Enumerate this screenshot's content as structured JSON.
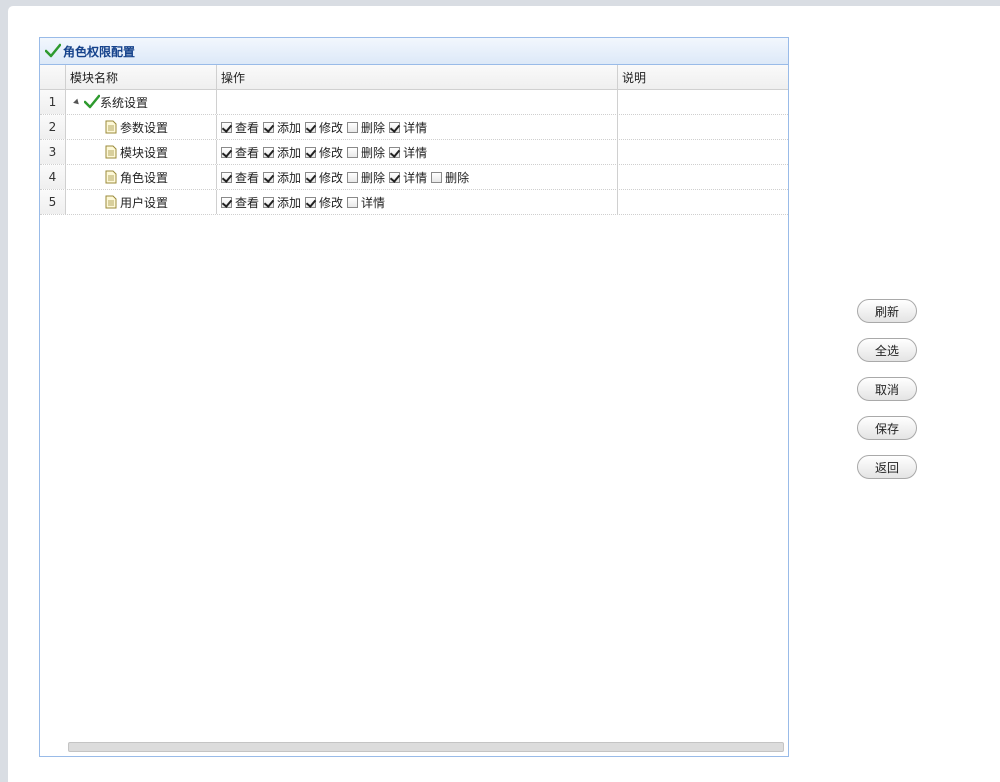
{
  "panel": {
    "title": "角色权限配置",
    "icon": "check-icon"
  },
  "grid": {
    "columns": [
      "模块名称",
      "操作",
      "说明"
    ],
    "rows": [
      {
        "num": "1",
        "name": "系统设置",
        "type": "folder",
        "ops": [],
        "desc": ""
      },
      {
        "num": "2",
        "name": "参数设置",
        "type": "leaf",
        "ops": [
          {
            "label": "查看",
            "checked": true
          },
          {
            "label": "添加",
            "checked": true
          },
          {
            "label": "修改",
            "checked": true
          },
          {
            "label": "删除",
            "checked": false
          },
          {
            "label": "详情",
            "checked": true
          }
        ],
        "desc": ""
      },
      {
        "num": "3",
        "name": "模块设置",
        "type": "leaf",
        "ops": [
          {
            "label": "查看",
            "checked": true
          },
          {
            "label": "添加",
            "checked": true
          },
          {
            "label": "修改",
            "checked": true
          },
          {
            "label": "删除",
            "checked": false
          },
          {
            "label": "详情",
            "checked": true
          }
        ],
        "desc": ""
      },
      {
        "num": "4",
        "name": "角色设置",
        "type": "leaf",
        "ops": [
          {
            "label": "查看",
            "checked": true
          },
          {
            "label": "添加",
            "checked": true
          },
          {
            "label": "修改",
            "checked": true
          },
          {
            "label": "删除",
            "checked": false
          },
          {
            "label": "详情",
            "checked": true
          },
          {
            "label": "删除",
            "checked": false
          }
        ],
        "desc": ""
      },
      {
        "num": "5",
        "name": "用户设置",
        "type": "leaf",
        "ops": [
          {
            "label": "查看",
            "checked": true
          },
          {
            "label": "添加",
            "checked": true
          },
          {
            "label": "修改",
            "checked": true
          },
          {
            "label": "详情",
            "checked": false
          }
        ],
        "desc": ""
      }
    ]
  },
  "buttons": {
    "refresh": "刷新",
    "select_all": "全选",
    "cancel": "取消",
    "save": "保存",
    "back": "返回"
  },
  "colors": {
    "header_text": "#15428b",
    "border": "#99bbe8",
    "check_green": "#2e9a2e"
  }
}
